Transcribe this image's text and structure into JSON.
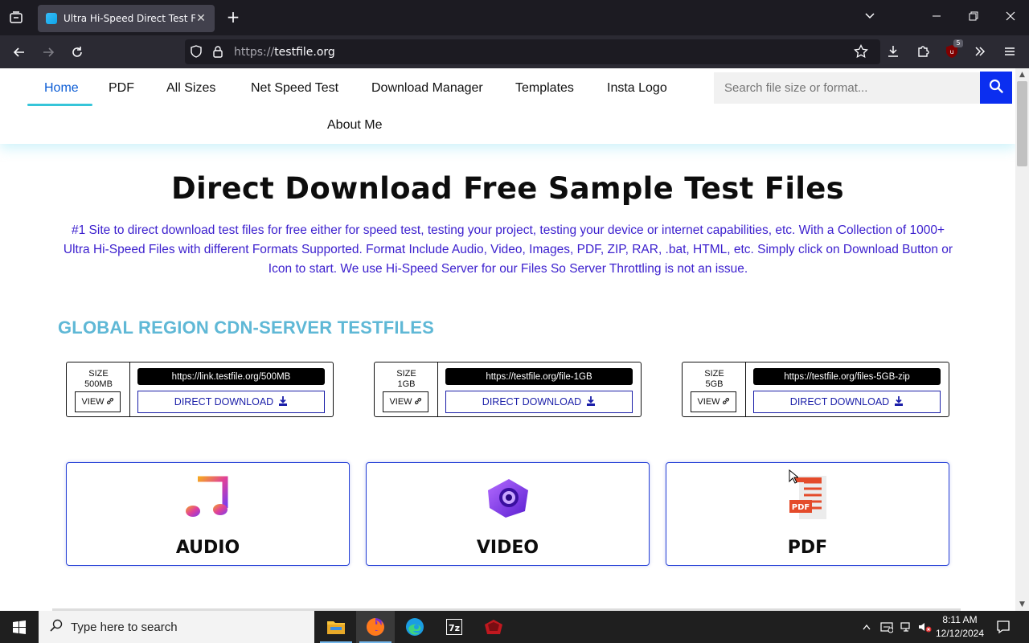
{
  "browser": {
    "tab_title": "Ultra Hi-Speed Direct Test Files |",
    "url_protocol": "https://",
    "url_host": "testfile.org",
    "extension_badge": "5"
  },
  "menu": {
    "items": [
      "Home",
      "PDF",
      "All Sizes",
      "Net Speed Test",
      "Download Manager",
      "Templates",
      "Insta Logo",
      "About Me"
    ],
    "active": "Home"
  },
  "search": {
    "placeholder": "Search file size or format..."
  },
  "hero": {
    "title": "Direct Download Free Sample Test Files",
    "description": "#1 Site to direct download test files for free either for speed test, testing your project, testing your device or internet capabilities, etc. With a Collection of 1000+  Ultra Hi-Speed Files with different Formats Supported. Format Include Audio, Video, Images, PDF,  ZIP, RAR, .bat, HTML, etc. Simply click on Download Button or Icon to start. We use Hi-Speed Server for our Files So Server Throttling is not an issue."
  },
  "cdn": {
    "section_title": "GLOBAL REGION CDN-SERVER TESTFILES",
    "cards": [
      {
        "size_label": "SIZE",
        "size_value": "500MB",
        "view_label": "VIEW",
        "url": "https://link.testfile.org/500MB",
        "download_label": "DIRECT DOWNLOAD"
      },
      {
        "size_label": "SIZE",
        "size_value": "1GB",
        "view_label": "VIEW",
        "url": "https://testfile.org/file-1GB",
        "download_label": "DIRECT DOWNLOAD"
      },
      {
        "size_label": "SIZE",
        "size_value": "5GB",
        "view_label": "VIEW",
        "url": "https://testfile.org/files-5GB-zip",
        "download_label": "DIRECT DOWNLOAD"
      }
    ]
  },
  "categories": [
    {
      "label": "AUDIO",
      "icon": "music-note-icon"
    },
    {
      "label": "VIDEO",
      "icon": "camera-icon"
    },
    {
      "label": "PDF",
      "icon": "pdf-file-icon"
    }
  ],
  "taskbar": {
    "search_placeholder": "Type here to search",
    "time": "8:11 AM",
    "date": "12/12/2024"
  },
  "colors": {
    "accent_blue": "#0b2ef0",
    "menu_active": "#0b5cd5",
    "description_text": "#3b1fce",
    "section_title": "#5fb8d6"
  }
}
